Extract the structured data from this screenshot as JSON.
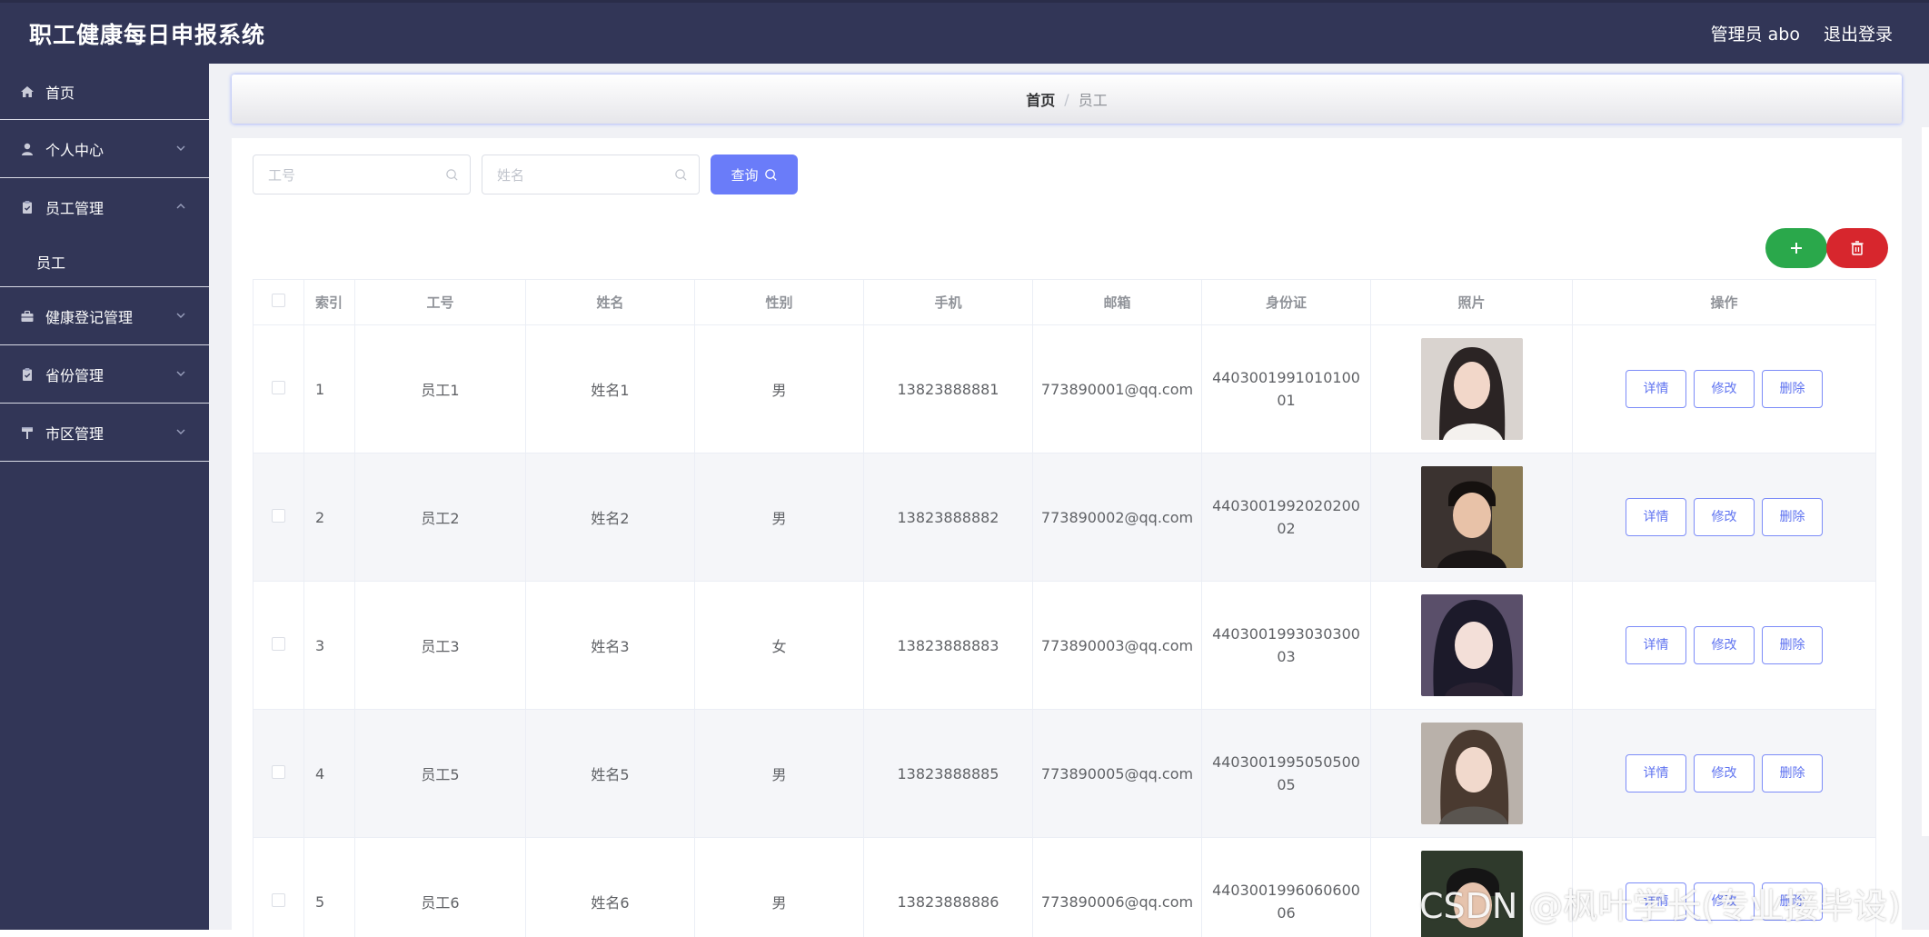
{
  "header": {
    "app_title": "职工健康每日申报系统",
    "user_label": "管理员 abo",
    "logout_label": "退出登录"
  },
  "sidebar": {
    "items": [
      {
        "label": "首页",
        "icon": "home-icon"
      },
      {
        "label": "个人中心",
        "icon": "user-icon",
        "expanded": false
      },
      {
        "label": "员工管理",
        "icon": "clipboard-icon",
        "expanded": true,
        "children": [
          "员工"
        ]
      },
      {
        "label": "健康登记管理",
        "icon": "briefcase-icon",
        "expanded": false
      },
      {
        "label": "省份管理",
        "icon": "clipboard-icon",
        "expanded": false
      },
      {
        "label": "市区管理",
        "icon": "road-sign-icon",
        "expanded": false
      }
    ]
  },
  "breadcrumb": {
    "home": "首页",
    "separator": "/",
    "current": "员工"
  },
  "search": {
    "id_placeholder": "工号",
    "name_placeholder": "姓名",
    "button_label": "查询"
  },
  "table": {
    "columns": [
      "索引",
      "工号",
      "姓名",
      "性别",
      "手机",
      "邮箱",
      "身份证",
      "照片",
      "操作"
    ],
    "actions": [
      "详情",
      "修改",
      "删除"
    ],
    "rows": [
      {
        "index": "1",
        "emp_id": "员工1",
        "name": "姓名1",
        "gender": "男",
        "phone": "13823888881",
        "email": "773890001@qq.com",
        "id_card": "440300199101010001"
      },
      {
        "index": "2",
        "emp_id": "员工2",
        "name": "姓名2",
        "gender": "男",
        "phone": "13823888882",
        "email": "773890002@qq.com",
        "id_card": "440300199202020002"
      },
      {
        "index": "3",
        "emp_id": "员工3",
        "name": "姓名3",
        "gender": "女",
        "phone": "13823888883",
        "email": "773890003@qq.com",
        "id_card": "440300199303030003"
      },
      {
        "index": "4",
        "emp_id": "员工5",
        "name": "姓名5",
        "gender": "男",
        "phone": "13823888885",
        "email": "773890005@qq.com",
        "id_card": "440300199505050005"
      },
      {
        "index": "5",
        "emp_id": "员工6",
        "name": "姓名6",
        "gender": "男",
        "phone": "13823888886",
        "email": "773890006@qq.com",
        "id_card": "440300199606060006"
      }
    ]
  },
  "colors": {
    "header_bg": "#323657",
    "primary": "#6a7cf9",
    "success": "#2aa84b",
    "danger": "#d7262d"
  },
  "watermark": "CSDN @枫叶学长(专业接毕设)"
}
